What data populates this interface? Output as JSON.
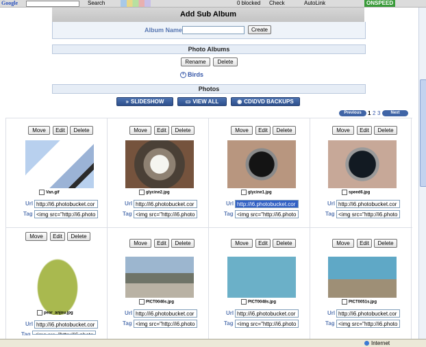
{
  "toolbar": {
    "logo": "Google",
    "search_label": "Search",
    "blocked": "0 blocked",
    "check": "Check",
    "autolink": "AutoLink",
    "onspeed": "ONSPEED"
  },
  "status": {
    "zone": "Internet"
  },
  "subalbum": {
    "title": "Add Sub Album",
    "name_label": "Album Name",
    "name_value": "",
    "create_label": "Create"
  },
  "albums": {
    "title": "Photo Albums",
    "rename_label": "Rename",
    "delete_label": "Delete",
    "current": "Birds"
  },
  "photos": {
    "title": "Photos",
    "slideshow_label": "SLIDESHOW",
    "viewall_label": "VIEW ALL",
    "backup_label": "CD\\DVD BACKUPS",
    "prev_label": "Previous",
    "next_label": "Next",
    "pages": [
      "1",
      "2",
      "3"
    ],
    "current_page": "1",
    "move_label": "Move",
    "edit_label": "Edit",
    "delete_label": "Delete",
    "url_label": "Url",
    "tag_label": "Tag",
    "items": [
      {
        "file": "Van.gif",
        "url": "http://i6.photobucket.cor",
        "tag": "<img src=\"http://i6.photo"
      },
      {
        "file": "glycine2.jpg",
        "url": "http://i6.photobucket.cor",
        "tag": "<img src=\"http://i6.photo"
      },
      {
        "file": "glycine1.jpg",
        "url": "http://i6.photobucket.cor",
        "tag": "<img src=\"http://i6.photo"
      },
      {
        "file": "speed6.jpg",
        "url": "http://i6.photobucket.cor",
        "tag": "<img src=\"http://i6.photo"
      },
      {
        "file": "pear_anjou.jpg",
        "url": "http://i6.photobucket.cor",
        "tag": "<img src=\"http://i6.photo"
      },
      {
        "file": "PICT0046s.jpg",
        "url": "http://i6.photobucket.cor",
        "tag": "<img src=\"http://i6.photo"
      },
      {
        "file": "PICT0048s.jpg",
        "url": "http://i6.photobucket.cor",
        "tag": "<img src=\"http://i6.photo"
      },
      {
        "file": "PICT0051s.jpg",
        "url": "http://i6.photobucket.cor",
        "tag": "<img src=\"http://i6.photo"
      }
    ]
  }
}
